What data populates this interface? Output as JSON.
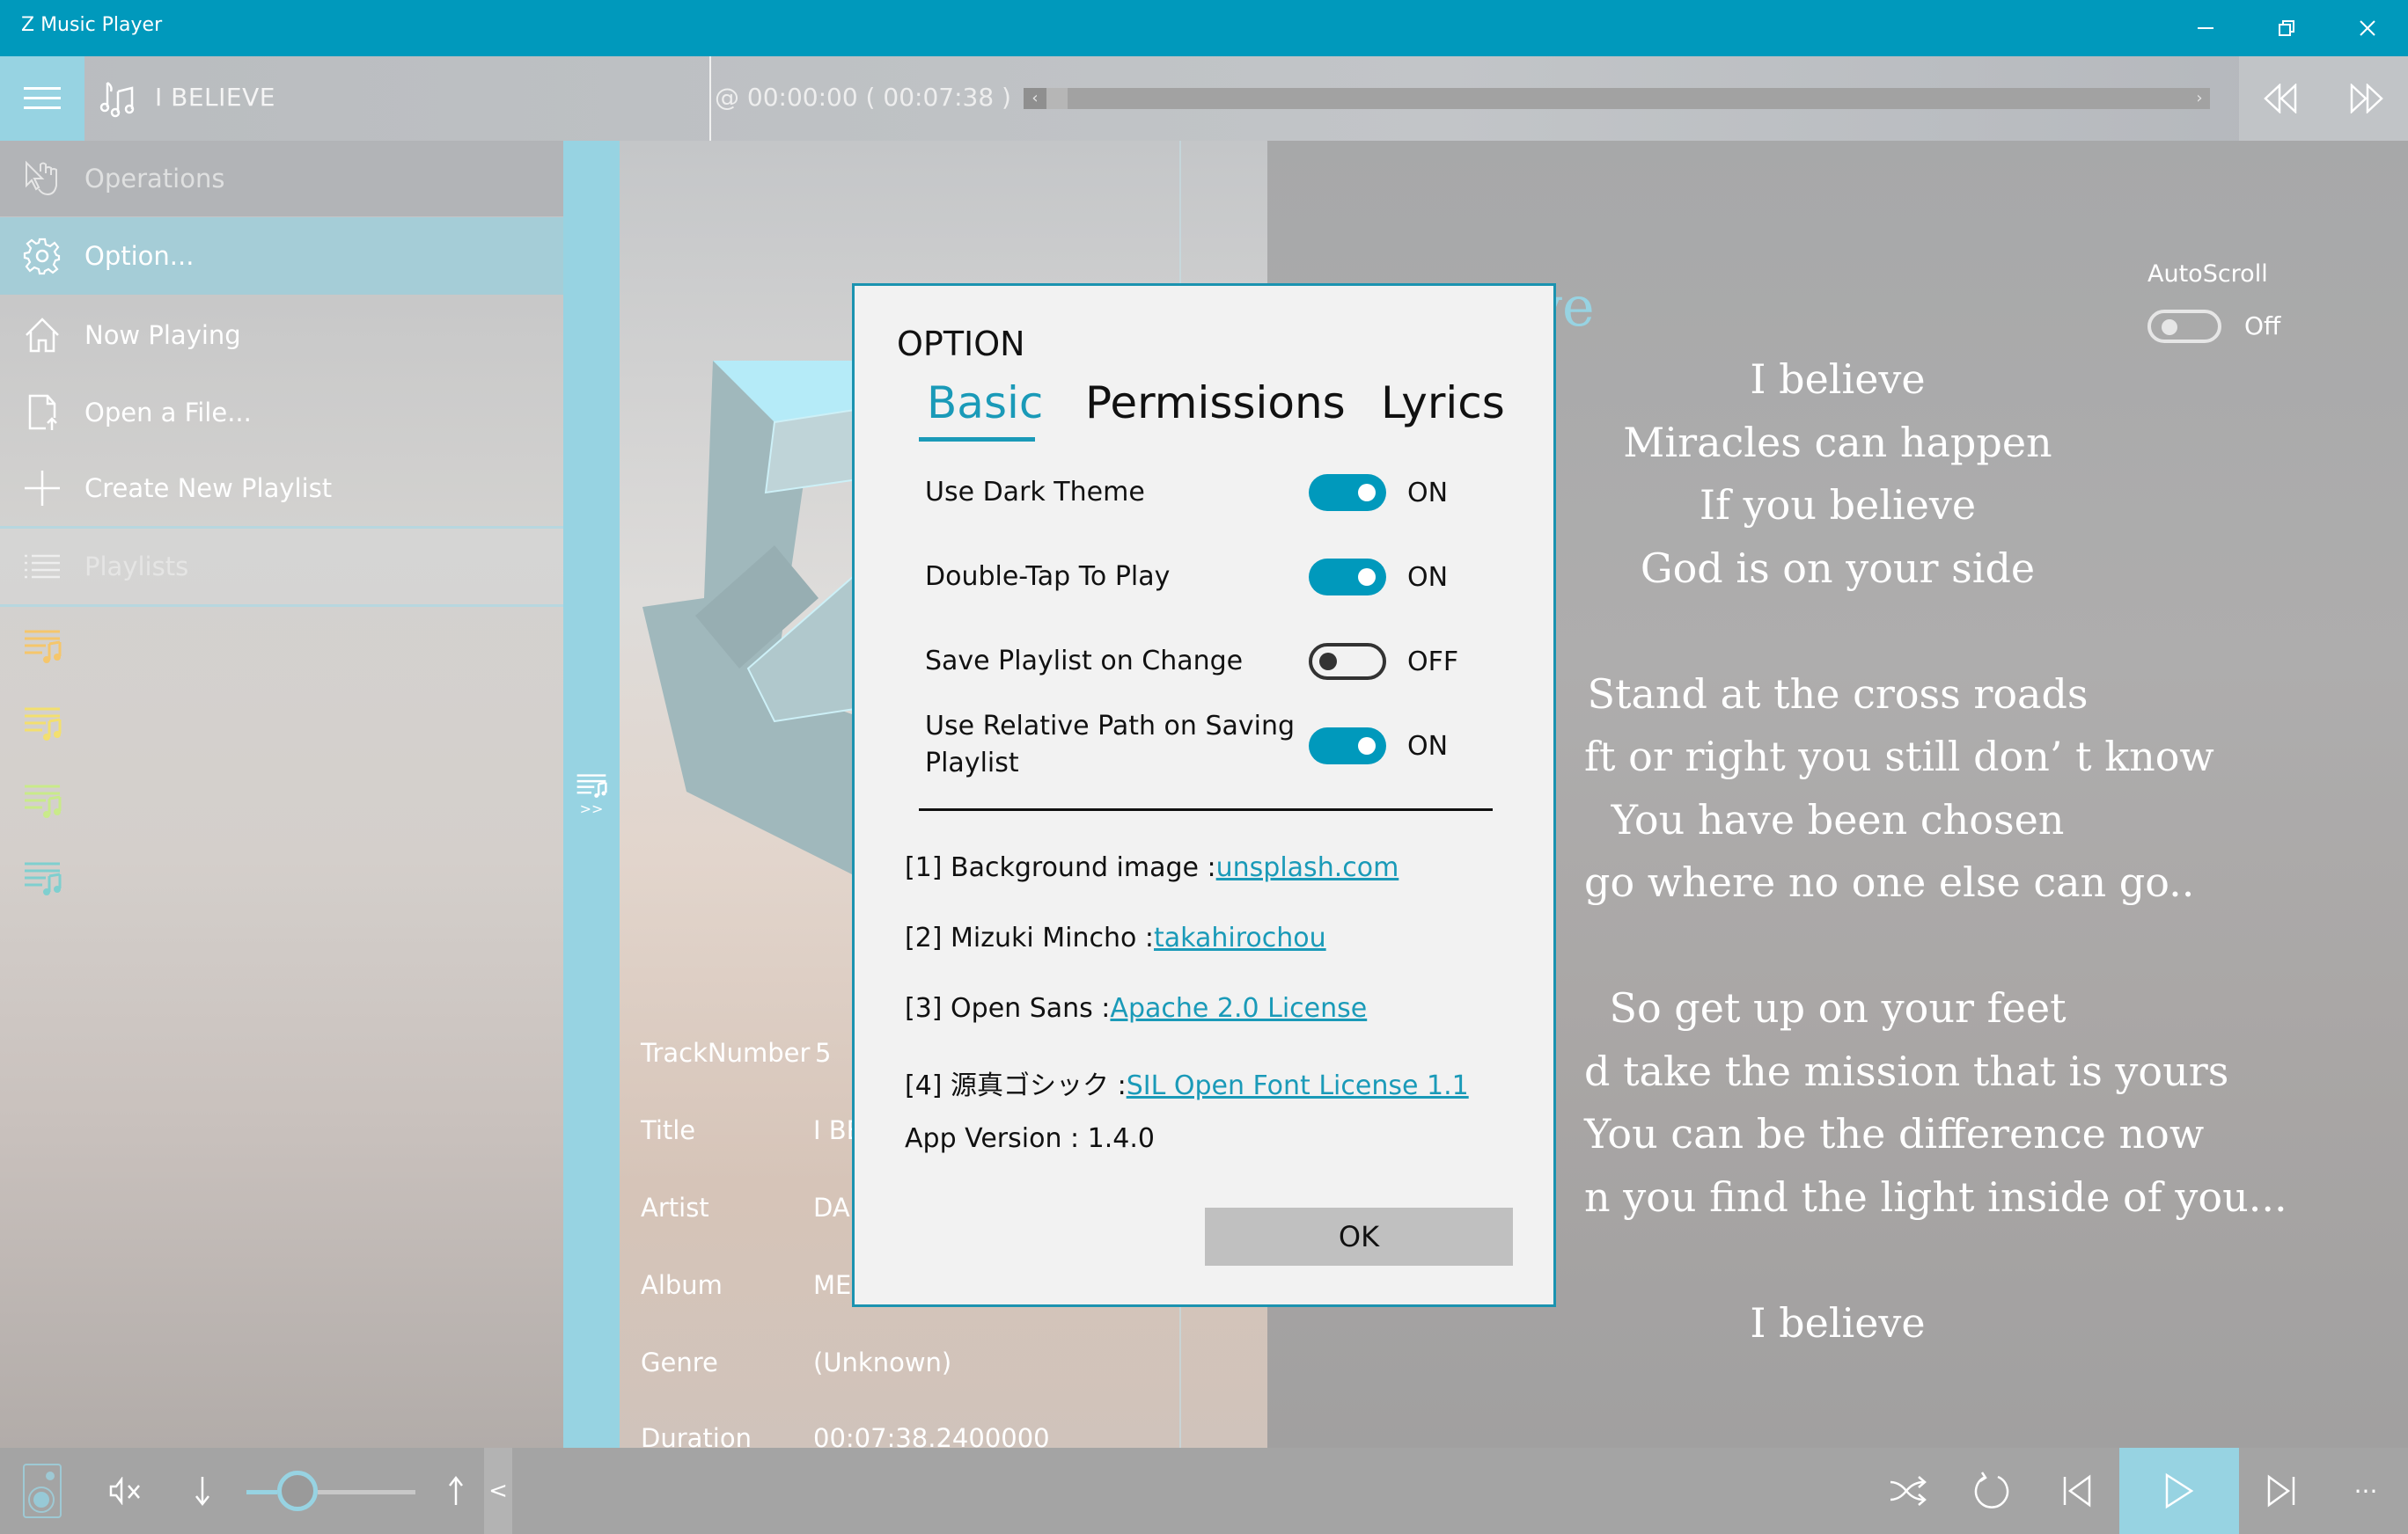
{
  "window": {
    "title": "Z Music Player",
    "controls": [
      "minimize",
      "restore",
      "close"
    ]
  },
  "topbar": {
    "song_title": "I BELIEVE",
    "time_readout": "@ 00:00:00 ( 00:07:38 )",
    "seek_progress_fraction": 0.0,
    "seek_left_glyph": "‹",
    "seek_right_glyph": "›"
  },
  "sidebar": {
    "items": [
      {
        "label": "Operations",
        "icon": "hand-pointer-icon",
        "state": "header"
      },
      {
        "label": "Option...",
        "icon": "gear-icon",
        "state": "selected"
      },
      {
        "label": "Now Playing",
        "icon": "home-icon",
        "state": "normal"
      },
      {
        "label": "Open a File...",
        "icon": "open-file-icon",
        "state": "normal"
      },
      {
        "label": "Create New Playlist",
        "icon": "plus-icon",
        "state": "normal"
      },
      {
        "label": "Playlists",
        "icon": "list-icon",
        "state": "header"
      }
    ],
    "playlist_icon_colors": [
      "#f5c66b",
      "#f3df6f",
      "#c9ea8a",
      "#7fcfcf"
    ],
    "strip_label": ">>"
  },
  "track_info": {
    "rows": [
      {
        "label": "TrackNumber",
        "value": "5"
      },
      {
        "label": "Title",
        "value": "I BE"
      },
      {
        "label": "Artist",
        "value": "DA"
      },
      {
        "label": "Album",
        "value": "ME"
      },
      {
        "label": "Genre",
        "value": "(Unknown)"
      },
      {
        "label": "Duration",
        "value": "00:07:38.2400000"
      }
    ]
  },
  "lyrics_panel": {
    "autoscroll_label": "AutoScroll",
    "autoscroll_state": "Off",
    "title_fragment": "ve",
    "lines": [
      "I believe",
      "Miracles can happen",
      "If you believe",
      "God is on your side",
      "",
      "Stand at the cross roads",
      "ft or right you still don’ t know",
      "You have been chosen",
      "go where no one else can go..",
      "",
      "So get up on your feet",
      "d take the mission that is yours",
      "You can be the difference now",
      "n you find the light inside of you...",
      "",
      "I believe"
    ]
  },
  "bottombar": {
    "volume_fraction": 0.3,
    "collapse_glyph": "<",
    "buttons": [
      "speaker",
      "mute",
      "volume-down",
      "volume-up",
      "shuffle",
      "repeat",
      "previous",
      "play",
      "next",
      "more"
    ],
    "more_glyph": "···"
  },
  "dialog": {
    "title": "OPTION",
    "tabs": [
      "Basic",
      "Permissions",
      "Lyrics"
    ],
    "active_tab": "Basic",
    "options": [
      {
        "label": "Use Dark Theme",
        "on": true,
        "state_text": "ON"
      },
      {
        "label": "Double-Tap To Play",
        "on": true,
        "state_text": "ON"
      },
      {
        "label": "Save Playlist on Change",
        "on": false,
        "state_text": "OFF"
      },
      {
        "label": "Use Relative Path on Saving Playlist",
        "on": true,
        "state_text": "ON"
      }
    ],
    "credits": [
      {
        "prefix": "[1] Background image :",
        "link": "unsplash.com"
      },
      {
        "prefix": "[2] Mizuki Mincho :",
        "link": "takahirochou"
      },
      {
        "prefix": "[3] Open Sans :",
        "link": "Apache 2.0 License"
      },
      {
        "prefix": "[4] 源真ゴシック :",
        "link": "SIL Open Font License 1.1"
      }
    ],
    "app_version": "App Version : 1.4.0",
    "ok_label": "OK"
  },
  "colors": {
    "accent": "#0099bc",
    "accent_light": "#97d3e2",
    "link": "#1a9ab8"
  }
}
